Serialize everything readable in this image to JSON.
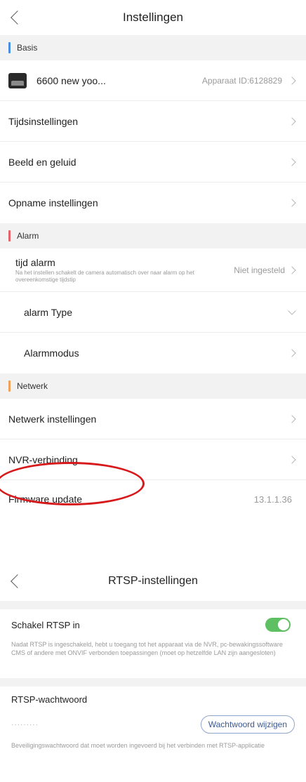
{
  "screen1": {
    "title": "Instellingen",
    "sections": {
      "basis": {
        "label": "Basis",
        "color": "#4a90e2"
      },
      "alarm": {
        "label": "Alarm",
        "color": "#e8626a"
      },
      "netwerk": {
        "label": "Netwerk",
        "color": "#f0a15a"
      }
    },
    "device": {
      "name": "6600 new yoo...",
      "id_text": "Apparaat ID:6128829"
    },
    "items": {
      "tijd": "Tijdsinstellingen",
      "beeld": "Beeld en geluid",
      "opname": "Opname instellingen",
      "tijd_alarm": "tijd alarm",
      "tijd_alarm_sub": "Na het instellen schakelt de camera automatisch over naar alarm op het overeenkomstige tijdstip",
      "tijd_alarm_value": "Niet ingesteld",
      "alarm_type": "alarm Type",
      "alarmmodus": "Alarmmodus",
      "netwerk_inst": "Netwerk instellingen",
      "nvr": "NVR-verbinding",
      "firmware": "Firmware update",
      "firmware_version": "13.1.1.36"
    },
    "highlight_color": "#d7191c"
  },
  "screen2": {
    "title": "RTSP-instellingen",
    "enable_label": "Schakel RTSP in",
    "enable_state": true,
    "enable_desc": "Nadat RTSP is ingeschakeld, hebt u toegang tot het apparaat via de NVR, pc-bewakingssoftware CMS of andere met ONVIF verbonden toepassingen (moet op hetzelfde LAN zijn aangesloten)",
    "password_label": "RTSP-wachtwoord",
    "password_mask": "·········",
    "change_password_button": "Wachtwoord wijzigen",
    "password_desc": "Beveiligingswachtwoord dat moet worden ingevoerd bij het verbinden met RTSP-applicatie",
    "toggle_color": "#5fbf63"
  }
}
